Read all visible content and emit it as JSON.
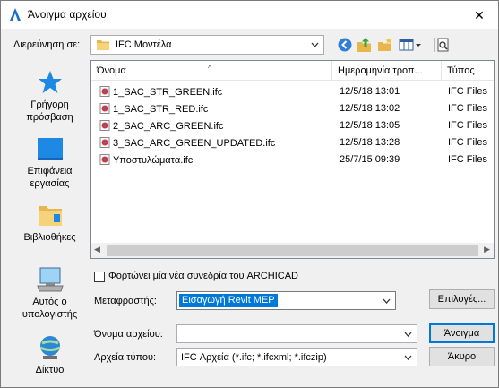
{
  "window": {
    "title": "Άνοιγμα αρχείου",
    "close_glyph": "✕"
  },
  "lookin": {
    "label": "Διερεύνηση σε:",
    "value": "IFC Μοντέλα"
  },
  "toolbar": {
    "icons": [
      "back-icon",
      "up-folder-icon",
      "new-folder-icon",
      "view-menu-icon",
      "preview-icon"
    ]
  },
  "places": [
    {
      "label_line1": "Γρήγορη",
      "label_line2": "πρόσβαση",
      "icon": "star-icon"
    },
    {
      "label_line1": "Επιφάνεια",
      "label_line2": "εργασίας",
      "icon": "desktop-icon"
    },
    {
      "label_line1": "Βιβλιοθήκες",
      "label_line2": "",
      "icon": "libraries-icon"
    },
    {
      "label_line1": "Αυτός ο",
      "label_line2": "υπολογιστής",
      "icon": "computer-icon"
    },
    {
      "label_line1": "Δίκτυο",
      "label_line2": "",
      "icon": "network-icon"
    }
  ],
  "filelist": {
    "columns": [
      "Όνομα",
      "Ημερομηνία τροπ...",
      "Τύπος"
    ],
    "rows": [
      {
        "name": "1_SAC_STR_GREEN.ifc",
        "date": "12/5/18 13:01",
        "type": "IFC Files"
      },
      {
        "name": "1_SAC_STR_RED.ifc",
        "date": "12/5/18 13:02",
        "type": "IFC Files"
      },
      {
        "name": "2_SAC_ARC_GREEN.ifc",
        "date": "12/5/18 13:05",
        "type": "IFC Files"
      },
      {
        "name": "3_SAC_ARC_GREEN_UPDATED.ifc",
        "date": "12/5/18 13:28",
        "type": "IFC Files"
      },
      {
        "name": "Υποστυλώματα.ifc",
        "date": "25/7/15 09:39",
        "type": "IFC Files"
      }
    ]
  },
  "options": {
    "checkbox_label": "Φορτώνει μία νέα συνεδρία του ARCHICAD",
    "checked": false
  },
  "translator": {
    "label": "Μεταφραστής:",
    "value": "Εισαγωγή Revit MEP",
    "options_button": "Επιλογές..."
  },
  "filename": {
    "label": "Όνομα αρχείου:",
    "value": "",
    "open_button": "Άνοιγμα"
  },
  "filetype": {
    "label": "Αρχεία τύπου:",
    "value": "IFC Αρχεία (*.ifc; *.ifcxml; *.ifczip)",
    "cancel_button": "Άκυρο"
  },
  "colors": {
    "accent": "#0078d7",
    "folder": "#e8b64c"
  }
}
